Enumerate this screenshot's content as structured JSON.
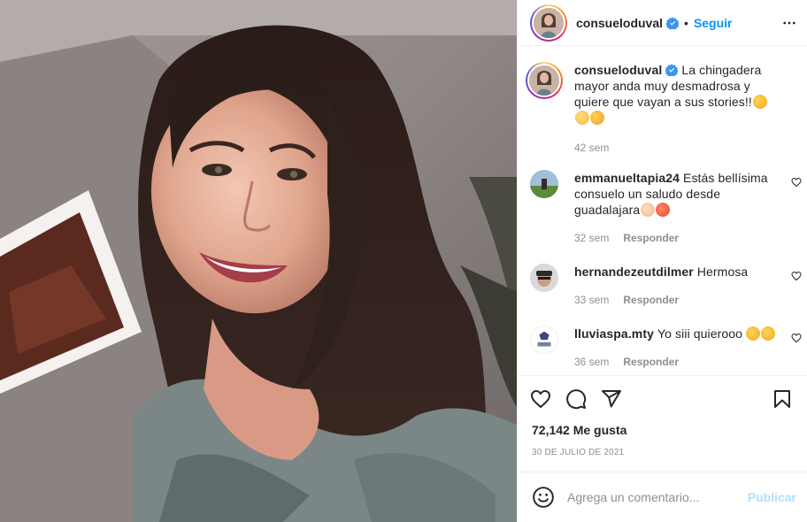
{
  "header": {
    "username": "consueloduval",
    "separator": "•",
    "follow_label": "Seguir"
  },
  "caption": {
    "username": "consueloduval",
    "text": "La chingadera mayor anda muy desmadrosa y quiere que vayan a sus stories!!",
    "time": "42 sem"
  },
  "comments": [
    {
      "username": "emmanueltapia24",
      "text": "Estás bellísima consuelo un saludo desde guadalajara",
      "time": "32 sem",
      "reply_label": "Responder"
    },
    {
      "username": "hernandezeutdilmer",
      "text": "Hermosa",
      "time": "33 sem",
      "reply_label": "Responder"
    },
    {
      "username": "lluviaspa.mty",
      "text": "Yo siii quierooo",
      "time": "36 sem",
      "reply_label": "Responder"
    }
  ],
  "likes": {
    "text": "72,142 Me gusta"
  },
  "date": "30 DE JULIO DE 2021",
  "composer": {
    "placeholder": "Agrega un comentario...",
    "publish_label": "Publicar"
  },
  "icons": {
    "verified": "verified-badge-icon",
    "more": "more-options-icon",
    "like": "heart-icon",
    "comment": "comment-icon",
    "share": "paper-plane-icon",
    "save": "bookmark-icon",
    "emoji": "smiley-icon"
  },
  "colors": {
    "accent": "#0095f6",
    "publish_disabled": "#b2dffc",
    "muted": "#8e8e8e",
    "text": "#262626"
  }
}
